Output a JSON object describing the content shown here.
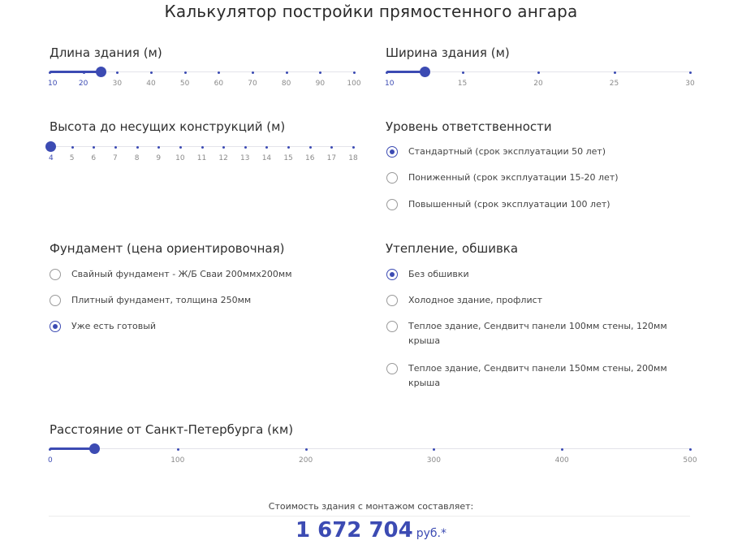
{
  "title": "Калькулятор постройки прямостенного ангара",
  "sliders": {
    "length": {
      "label": "Длина здания (м)",
      "min": 10,
      "max": 100,
      "value": 25,
      "ticks": [
        "10",
        "20",
        "30",
        "40",
        "50",
        "60",
        "70",
        "80",
        "90",
        "100"
      ],
      "active_ticks": [
        0,
        1
      ]
    },
    "width": {
      "label": "Ширина здания (м)",
      "min": 10,
      "max": 30,
      "value": 12.5,
      "ticks": [
        "10",
        "15",
        "20",
        "25",
        "30"
      ],
      "active_ticks": [
        0
      ]
    },
    "height": {
      "label": "Высота до несущих конструкций (м)",
      "min": 4,
      "max": 18,
      "value": 4,
      "ticks": [
        "4",
        "5",
        "6",
        "7",
        "8",
        "9",
        "10",
        "11",
        "12",
        "13",
        "14",
        "15",
        "16",
        "17",
        "18"
      ],
      "active_ticks": [
        0
      ]
    },
    "distance": {
      "label": "Расстояние от Санкт-Петербурга (км)",
      "min": 0,
      "max": 500,
      "value": 35,
      "ticks": [
        "0",
        "100",
        "200",
        "300",
        "400",
        "500"
      ],
      "active_ticks": [
        0
      ]
    }
  },
  "responsibility": {
    "label": "Уровень ответственности",
    "options": [
      {
        "text": "Стандартный (срок эксплуатации 50 лет)",
        "checked": true
      },
      {
        "text": "Пониженный (срок эксплуатации 15-20 лет)",
        "checked": false
      },
      {
        "text": "Повышенный (срок эксплуатации 100 лет)",
        "checked": false
      }
    ]
  },
  "foundation": {
    "label": "Фундамент (цена ориентировочная)",
    "options": [
      {
        "text": "Свайный фундамент - Ж/Б Сваи 200ммх200мм",
        "checked": false
      },
      {
        "text": "Плитный фундамент, толщина 250мм",
        "checked": false
      },
      {
        "text": "Уже есть готовый",
        "checked": true
      }
    ]
  },
  "insulation": {
    "label": "Утепление, обшивка",
    "options": [
      {
        "text": "Без обшивки",
        "checked": true
      },
      {
        "text": "Холодное здание, профлист",
        "checked": false
      },
      {
        "text": "Теплое здание, Сендвитч панели 100мм стены, 120мм крыша",
        "checked": false
      },
      {
        "text": "Теплое здание, Сендвитч панели 150мм стены, 200мм крыша",
        "checked": false
      }
    ]
  },
  "cost": {
    "label": "Стоимость здания с монтажом составляет:",
    "value": "1 672 704",
    "currency": "руб.*"
  },
  "colors": {
    "accent": "#3c4bb3",
    "track": "#e3e3ea",
    "tick": "#8a8a8a"
  }
}
